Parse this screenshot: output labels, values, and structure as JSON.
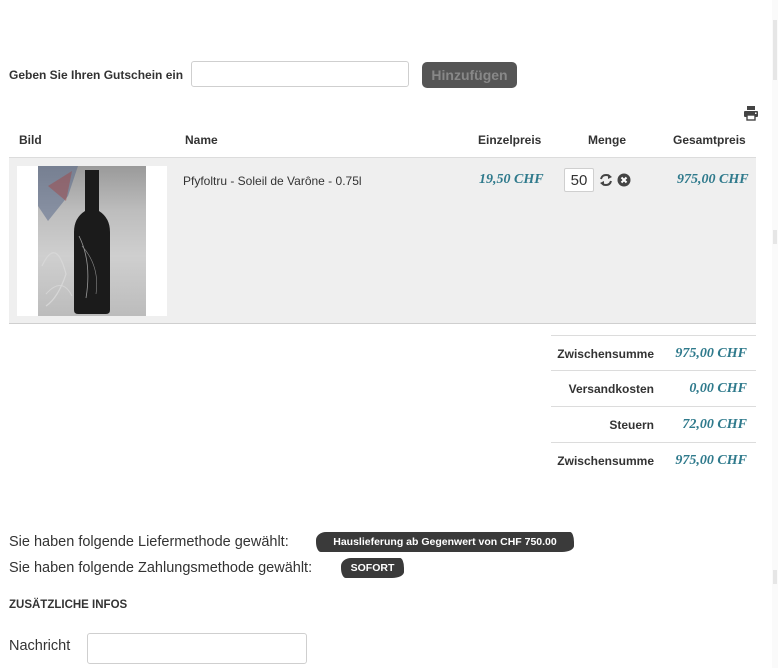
{
  "voucher": {
    "label": "Geben Sie Ihren Gutschein ein",
    "input_value": "",
    "input_placeholder": "",
    "button_label": "Hinzufügen"
  },
  "table": {
    "headers": {
      "image": "Bild",
      "name": "Name",
      "unit_price": "Einzelpreis",
      "quantity": "Menge",
      "total": "Gesamtpreis"
    },
    "rows": [
      {
        "name": "Pfyfoltru - Soleil de Varône - 0.75l",
        "unit_price": "19,50 CHF",
        "quantity": "50",
        "total": "975,00 CHF",
        "icons": [
          "refresh-icon",
          "remove-icon"
        ]
      }
    ]
  },
  "totals": [
    {
      "label": "Zwischensumme",
      "value": "975,00 CHF"
    },
    {
      "label": "Versandkosten",
      "value": "0,00 CHF"
    },
    {
      "label": "Steuern",
      "value": "72,00 CHF"
    },
    {
      "label": "Zwischensumme",
      "value": "975,00 CHF"
    }
  ],
  "delivery": {
    "label": "Sie haben folgende Liefermethode gewählt:",
    "value": "Hauslieferung ab Gegenwert von CHF 750.00"
  },
  "payment": {
    "label": "Sie haben folgende Zahlungsmethode gewählt:",
    "value": "SOFORT"
  },
  "extra_info": {
    "heading": "ZUSÄTZLICHE INFOS",
    "message_label": "Nachricht",
    "message_value": ""
  },
  "colors": {
    "price": "#2f7a8c",
    "row_bg": "#efefef",
    "button_bg": "#555555",
    "badge_bg": "#3a3a3a"
  },
  "icons": {
    "print": "print-icon",
    "refresh": "refresh-icon",
    "remove": "remove-icon"
  }
}
